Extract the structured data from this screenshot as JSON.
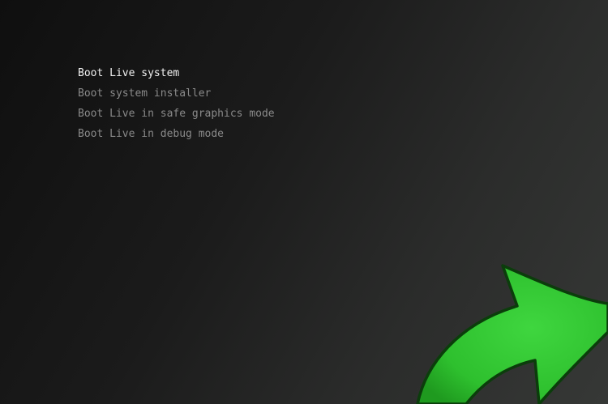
{
  "boot_menu": {
    "items": [
      {
        "label": "Boot Live system",
        "selected": true
      },
      {
        "label": "Boot system installer",
        "selected": false
      },
      {
        "label": "Boot Live in safe graphics mode",
        "selected": false
      },
      {
        "label": "Boot Live in debug mode",
        "selected": false
      }
    ]
  },
  "logo": {
    "icon": "green-arrow-icon",
    "color": "#2ec02e",
    "outline_color": "#0b3d0b"
  },
  "colors": {
    "selected_text": "#f2f2f2",
    "unselected_text": "#8a8a8a"
  }
}
